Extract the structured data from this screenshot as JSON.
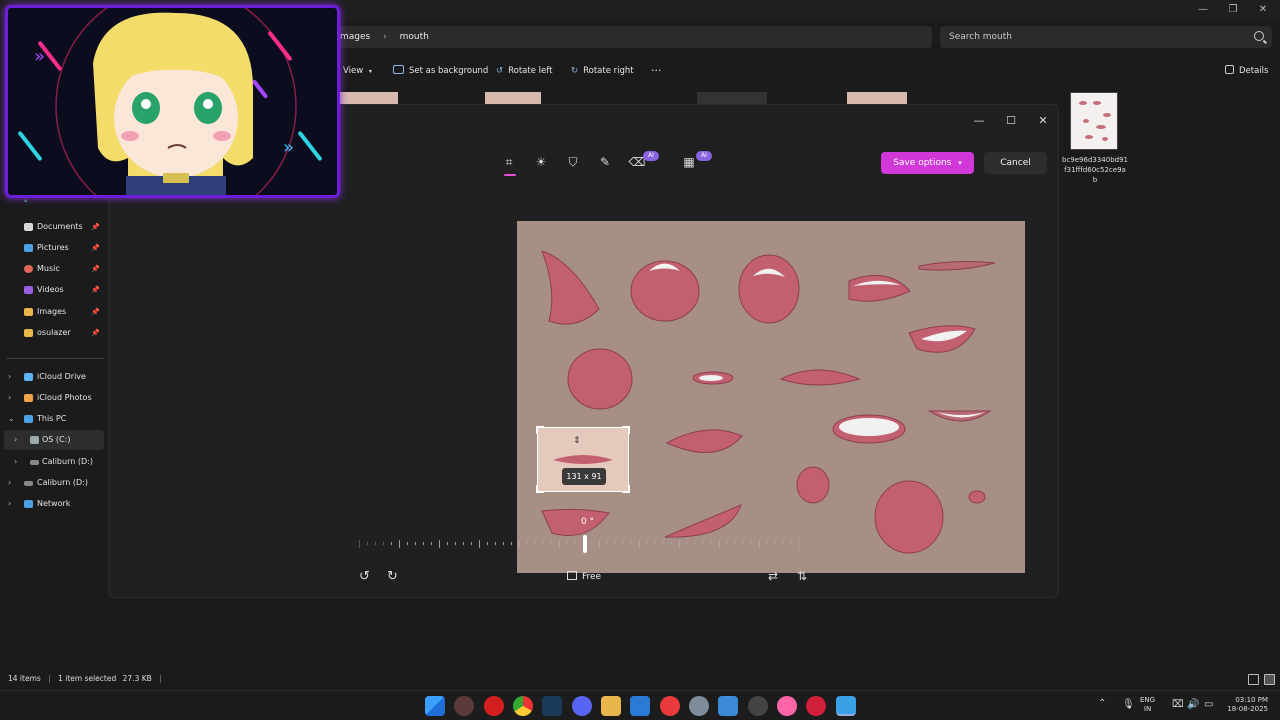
{
  "explorer": {
    "breadcrumb": [
      "mages",
      "mouth"
    ],
    "search_placeholder": "Search mouth",
    "toolbar": {
      "view": "View",
      "set_background": "Set as background",
      "rotate_left": "Rotate left",
      "rotate_right": "Rotate right",
      "more": "···",
      "details": "Details"
    },
    "file": {
      "name": "bc9e96d3340bd91f31fffd60c52ce9ab"
    },
    "sidebar": {
      "quick_access": [
        {
          "label": "Documents"
        },
        {
          "label": "Pictures"
        },
        {
          "label": "Music"
        },
        {
          "label": "Videos"
        },
        {
          "label": "Images"
        },
        {
          "label": "osulazer"
        }
      ],
      "locations": [
        {
          "label": "iCloud Drive"
        },
        {
          "label": "iCloud Photos"
        },
        {
          "label": "This PC"
        },
        {
          "label": "OS (C:)"
        },
        {
          "label": "Caliburn (D:)"
        },
        {
          "label": "Caliburn (D:)"
        },
        {
          "label": "Network"
        }
      ]
    },
    "status": {
      "items": "14 items",
      "selected": "1 item selected",
      "size": "27.3 KB"
    }
  },
  "editor": {
    "ai_badge": "AI",
    "save_options": "Save options",
    "cancel": "Cancel",
    "crop_size": "131 x 91",
    "angle": "0 °",
    "aspect": "Free"
  },
  "taskbar": {
    "lang_line1": "ENG",
    "lang_line2": "IN",
    "time": "03:10 PM",
    "date": "18-08-2025"
  },
  "colors": {
    "accent": "#d238d8",
    "overlay_border": "#6b1fd8",
    "canvas_bg": "#a78f86"
  }
}
